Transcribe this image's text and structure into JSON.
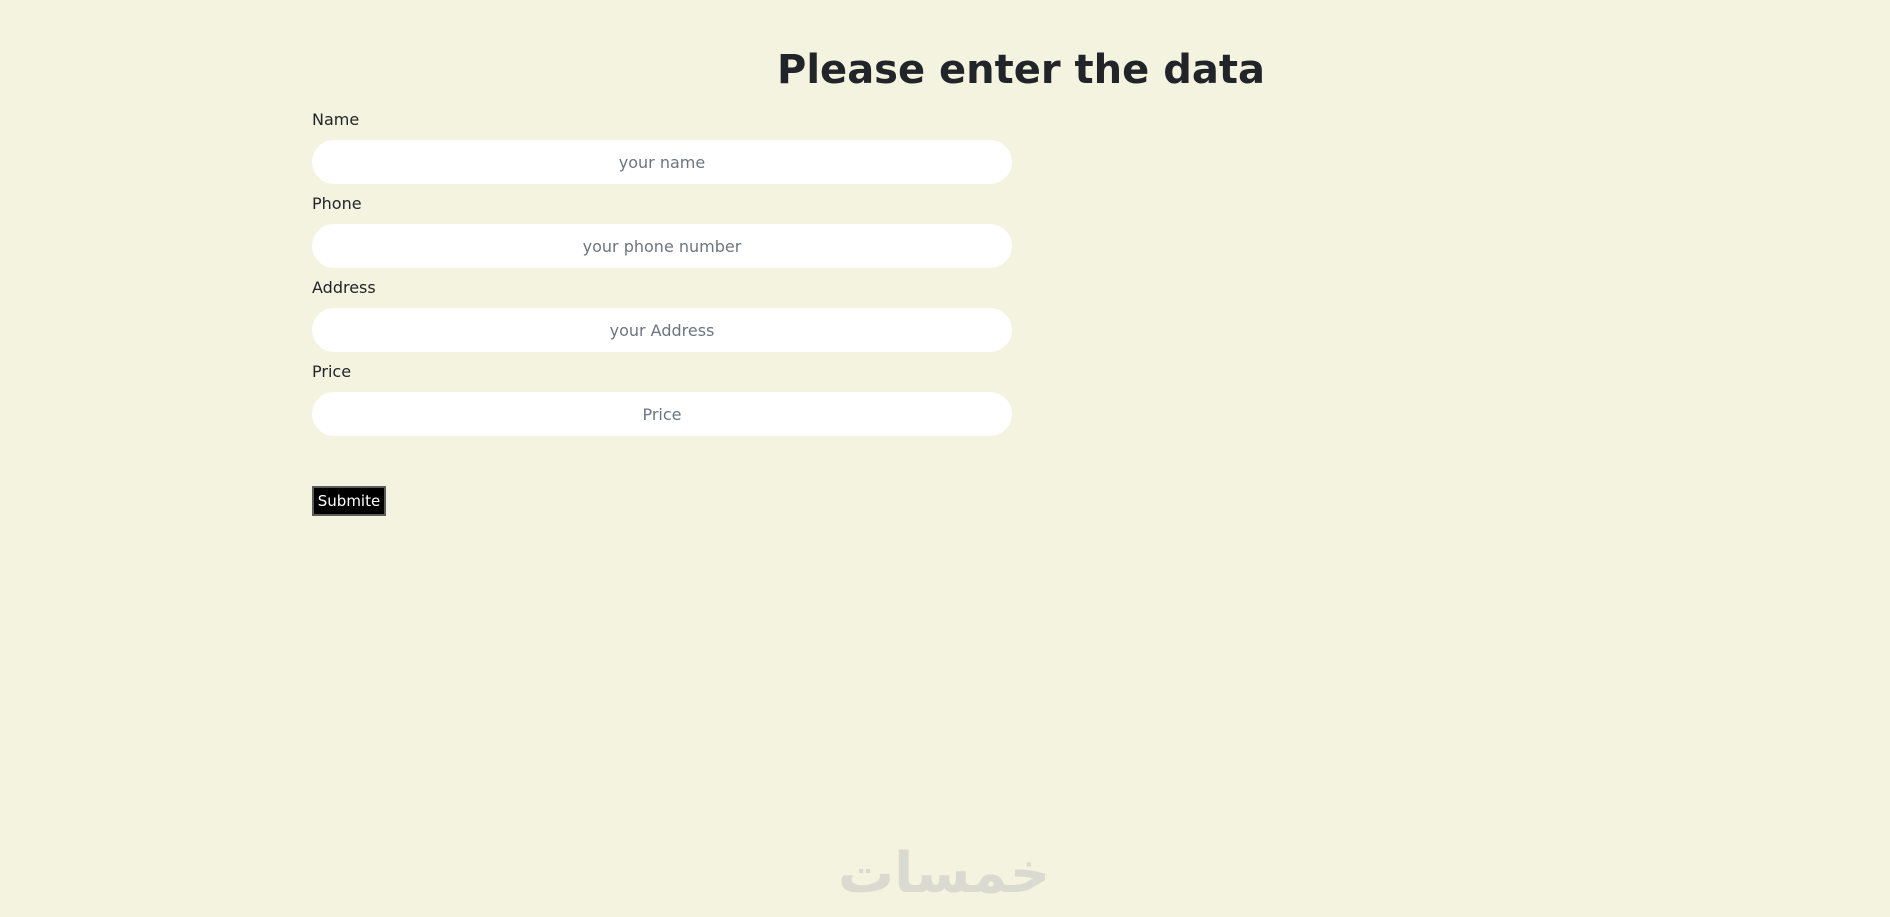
{
  "page": {
    "title": "Please enter the data"
  },
  "form": {
    "name": {
      "label": "Name",
      "placeholder": "your name",
      "value": ""
    },
    "phone": {
      "label": "Phone",
      "placeholder": "your phone number",
      "value": ""
    },
    "address": {
      "label": "Address",
      "placeholder": "your Address",
      "value": ""
    },
    "price": {
      "label": "Price",
      "placeholder": "Price",
      "value": ""
    },
    "submit_label": "Submite"
  },
  "watermark": {
    "text": "خمسات"
  },
  "colors": {
    "background": "#f4f3e0",
    "input_background": "#ffffff",
    "button_background": "#000000",
    "button_text": "#ffffff",
    "text": "#212529",
    "placeholder": "#6c757d",
    "watermark": "#dadad0"
  }
}
